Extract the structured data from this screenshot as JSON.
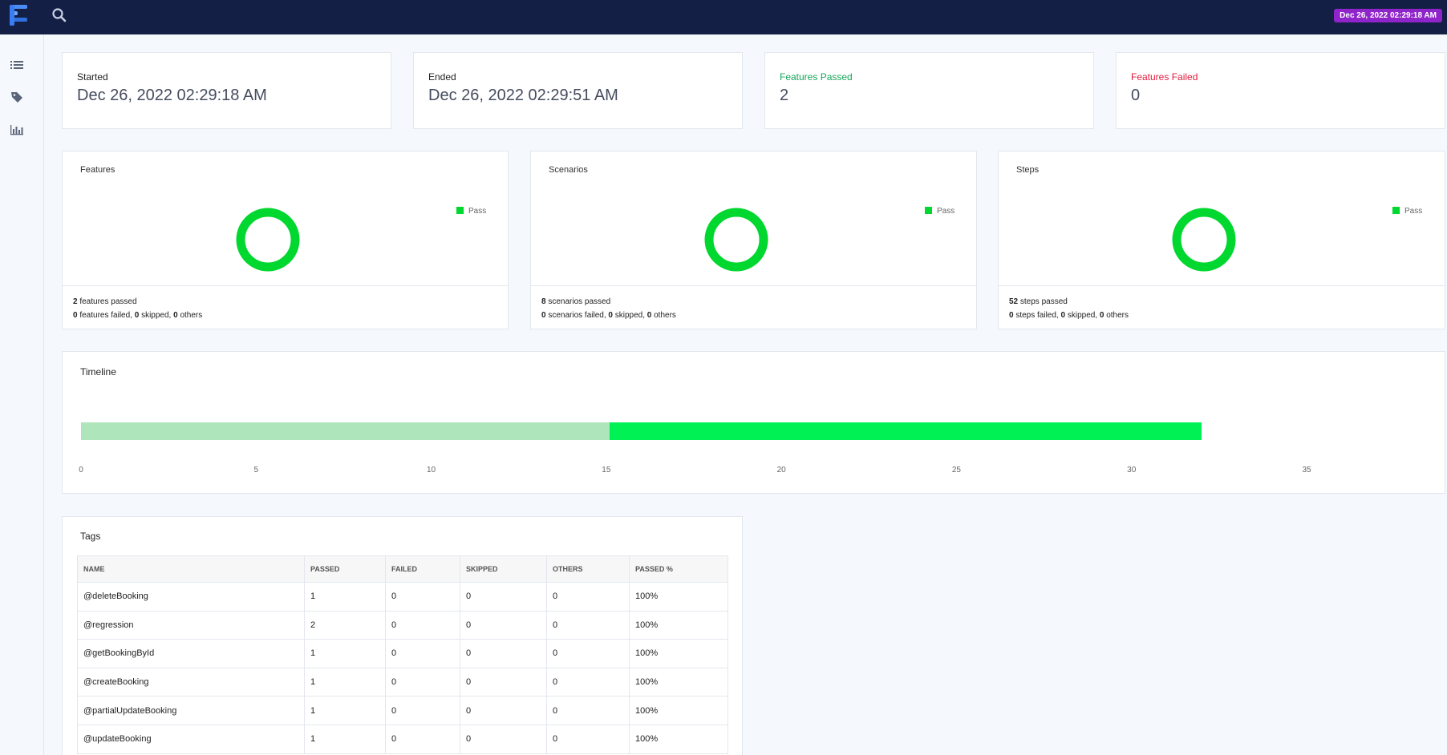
{
  "header": {
    "date_badge": "Dec 26, 2022 02:29:18 AM"
  },
  "icons": {
    "logo": "app-logo-icon",
    "search": "search-icon",
    "sidebar": [
      "list-icon",
      "tag-icon",
      "bar-chart-icon"
    ]
  },
  "colors": {
    "navbar": "#141f45",
    "pass": "#00d72f",
    "timeline_light": "#aee5bb",
    "timeline_bright": "#00f154",
    "passed_label": "#13a55a",
    "failed_label": "#e11a3c",
    "badge": "#8e24c9"
  },
  "stats": [
    {
      "label": "Started",
      "value": "Dec 26, 2022 02:29:18 AM"
    },
    {
      "label": "Ended",
      "value": "Dec 26, 2022 02:29:51 AM"
    },
    {
      "label": "Features Passed",
      "value": "2"
    },
    {
      "label": "Features Failed",
      "value": "0"
    }
  ],
  "charts": [
    {
      "title": "Features",
      "legend": "Pass",
      "passed_count": "2",
      "passed_text": "features passed",
      "failed_count": "0",
      "failed_text": "features failed,",
      "skipped_count": "0",
      "skipped_text": "skipped,",
      "others_count": "0",
      "others_text": "others"
    },
    {
      "title": "Scenarios",
      "legend": "Pass",
      "passed_count": "8",
      "passed_text": "scenarios passed",
      "failed_count": "0",
      "failed_text": "scenarios failed,",
      "skipped_count": "0",
      "skipped_text": "skipped,",
      "others_count": "0",
      "others_text": "others"
    },
    {
      "title": "Steps",
      "legend": "Pass",
      "passed_count": "52",
      "passed_text": "steps passed",
      "failed_count": "0",
      "failed_text": "steps failed,",
      "skipped_count": "0",
      "skipped_text": "skipped,",
      "others_count": "0",
      "others_text": "others"
    }
  ],
  "timeline": {
    "title": "Timeline",
    "ticks": [
      "0",
      "5",
      "10",
      "15",
      "20",
      "25",
      "30",
      "35"
    ],
    "axis_max": 35,
    "segments": [
      {
        "start": 0,
        "end": 15.1,
        "color": "#aee5bb"
      },
      {
        "start": 15.1,
        "end": 32.0,
        "color": "#00f154"
      }
    ]
  },
  "tags": {
    "title": "Tags",
    "columns": [
      "NAME",
      "PASSED",
      "FAILED",
      "SKIPPED",
      "OTHERS",
      "PASSED %"
    ],
    "rows": [
      [
        "@deleteBooking",
        "1",
        "0",
        "0",
        "0",
        "100%"
      ],
      [
        "@regression",
        "2",
        "0",
        "0",
        "0",
        "100%"
      ],
      [
        "@getBookingById",
        "1",
        "0",
        "0",
        "0",
        "100%"
      ],
      [
        "@createBooking",
        "1",
        "0",
        "0",
        "0",
        "100%"
      ],
      [
        "@partialUpdateBooking",
        "1",
        "0",
        "0",
        "0",
        "100%"
      ],
      [
        "@updateBooking",
        "1",
        "0",
        "0",
        "0",
        "100%"
      ]
    ]
  }
}
